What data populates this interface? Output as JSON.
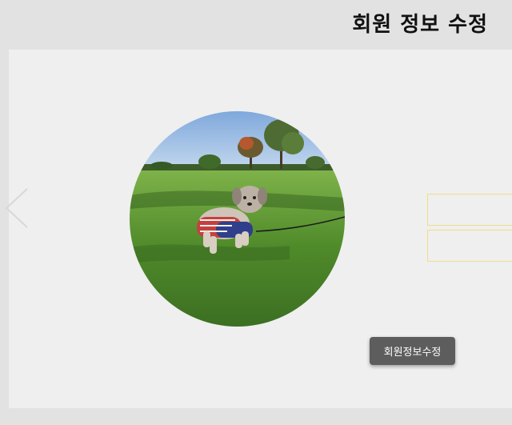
{
  "header": {
    "title": "회원 정보 수정"
  },
  "form": {
    "field_1_value": "",
    "field_2_value": "",
    "submit_label": "회원정보수정"
  },
  "icons": {
    "back": "chevron-left-icon"
  },
  "colors": {
    "background": "#e3e2e2",
    "panel": "#efefef",
    "field_border": "#f0dd84",
    "button": "#5d5d5d"
  }
}
